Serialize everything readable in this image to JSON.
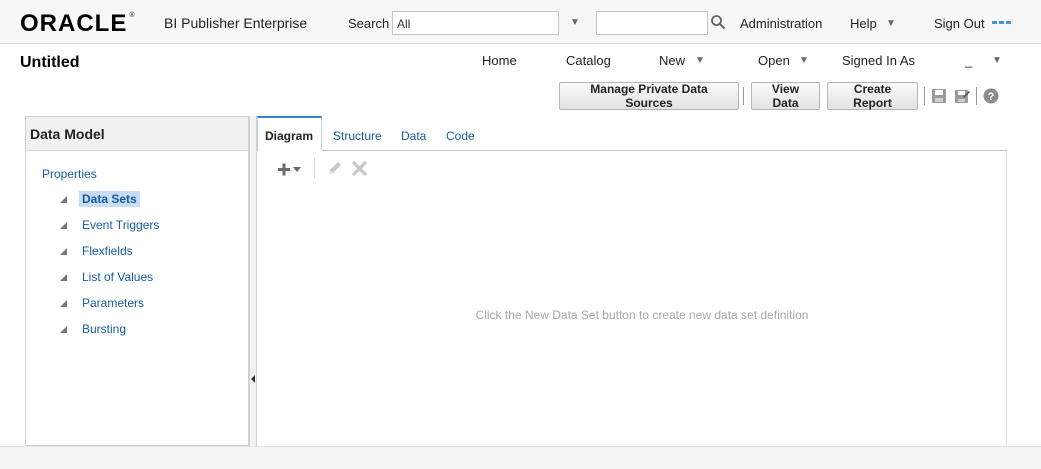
{
  "header": {
    "logo": "ORACLE",
    "logo_mark": "®",
    "product": "BI Publisher Enterprise",
    "search_label": "Search",
    "search_scope": "All",
    "search_value": "",
    "administration": "Administration",
    "help": "Help",
    "sign_out": "Sign Out"
  },
  "page": {
    "title": "Untitled"
  },
  "nav": {
    "home": "Home",
    "catalog": "Catalog",
    "new": "New",
    "open": "Open",
    "signed_in_as": "Signed In As",
    "user": "_"
  },
  "toolbar": {
    "manage_private": "Manage Private Data Sources",
    "view_data": "View Data",
    "create_report": "Create Report"
  },
  "data_model": {
    "title": "Data Model",
    "properties": "Properties",
    "items": [
      {
        "label": "Data Sets",
        "selected": true
      },
      {
        "label": "Event Triggers"
      },
      {
        "label": "Flexfields"
      },
      {
        "label": "List of Values"
      },
      {
        "label": "Parameters"
      },
      {
        "label": "Bursting"
      }
    ]
  },
  "tabs": [
    {
      "label": "Diagram",
      "active": true
    },
    {
      "label": "Structure"
    },
    {
      "label": "Data"
    },
    {
      "label": "Code"
    }
  ],
  "canvas": {
    "message": "Click the New Data Set button to create new data set definition"
  },
  "icons": {
    "search": "search-icon",
    "menu_dots": "dots-icon",
    "save": "save-icon",
    "save_as": "save-as-icon",
    "help": "help-icon",
    "add": "plus-dropdown-icon",
    "edit": "pencil-icon",
    "delete": "delete-icon",
    "collapse": "collapse-icon"
  },
  "colors": {
    "link": "#145c9e",
    "selected_bg": "#c9ddf2",
    "tab_accent": "#3a7dc8"
  }
}
